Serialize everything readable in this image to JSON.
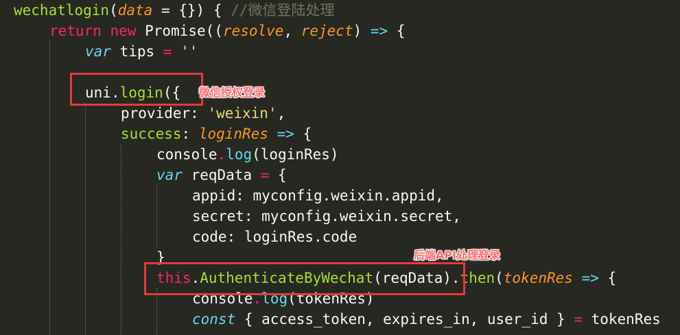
{
  "annotations": {
    "login_label": "微信授权登录",
    "backend_label": "后端API处理登录"
  },
  "code": {
    "l1": {
      "name": "wechatlogin",
      "p1": "(",
      "arg": "data",
      "p2": " = {}) { ",
      "comment": "//微信登陆处理"
    },
    "l2": {
      "kw_return": "return",
      "kw_new": "new",
      "cls": "Promise",
      "p1": "((",
      "resolve": "resolve",
      "comma": ", ",
      "reject": "reject",
      "p2": ") ",
      "arrow": "=>",
      "p3": " {"
    },
    "l3": {
      "kw_var": "var",
      "name": " tips ",
      "eq": "=",
      "sp": " ",
      "str": "''"
    },
    "l5": {
      "obj": "uni",
      "dot": ".",
      "fn": "login",
      "p": "({"
    },
    "l6": {
      "key": "provider: ",
      "str": "'weixin'",
      "tail": ","
    },
    "l7": {
      "key": "success",
      "colon": ": ",
      "arg": "loginRes",
      "sp": " ",
      "arrow": "=>",
      "tail": " {"
    },
    "l8": {
      "obj": "console",
      "dot": ".",
      "fn": "log",
      "tail": "(loginRes)"
    },
    "l9": {
      "kw_var": "var",
      "name": " reqData ",
      "eq": "=",
      "tail": " {"
    },
    "l10": {
      "text": "appid: myconfig.weixin.appid,"
    },
    "l11": {
      "text": "secret: myconfig.weixin.secret,"
    },
    "l12": {
      "text": "code: loginRes.code"
    },
    "l13": {
      "text": "}"
    },
    "l14": {
      "kw_this": "this",
      "dot": ".",
      "fn": "AuthenticateByWechat",
      "p1": "(reqData).",
      "fn2": "then",
      "p2": "(",
      "arg": "tokenRes",
      "sp": " ",
      "arrow": "=>",
      "tail": " {"
    },
    "l15": {
      "obj": "console",
      "dot": ".",
      "fn": "log",
      "tail": "(tokenRes)"
    },
    "l16": {
      "kw_const": "const",
      "tail": " { access_token, expires_in, user_id } ",
      "eq": "=",
      "tail2": " tokenRes"
    }
  }
}
